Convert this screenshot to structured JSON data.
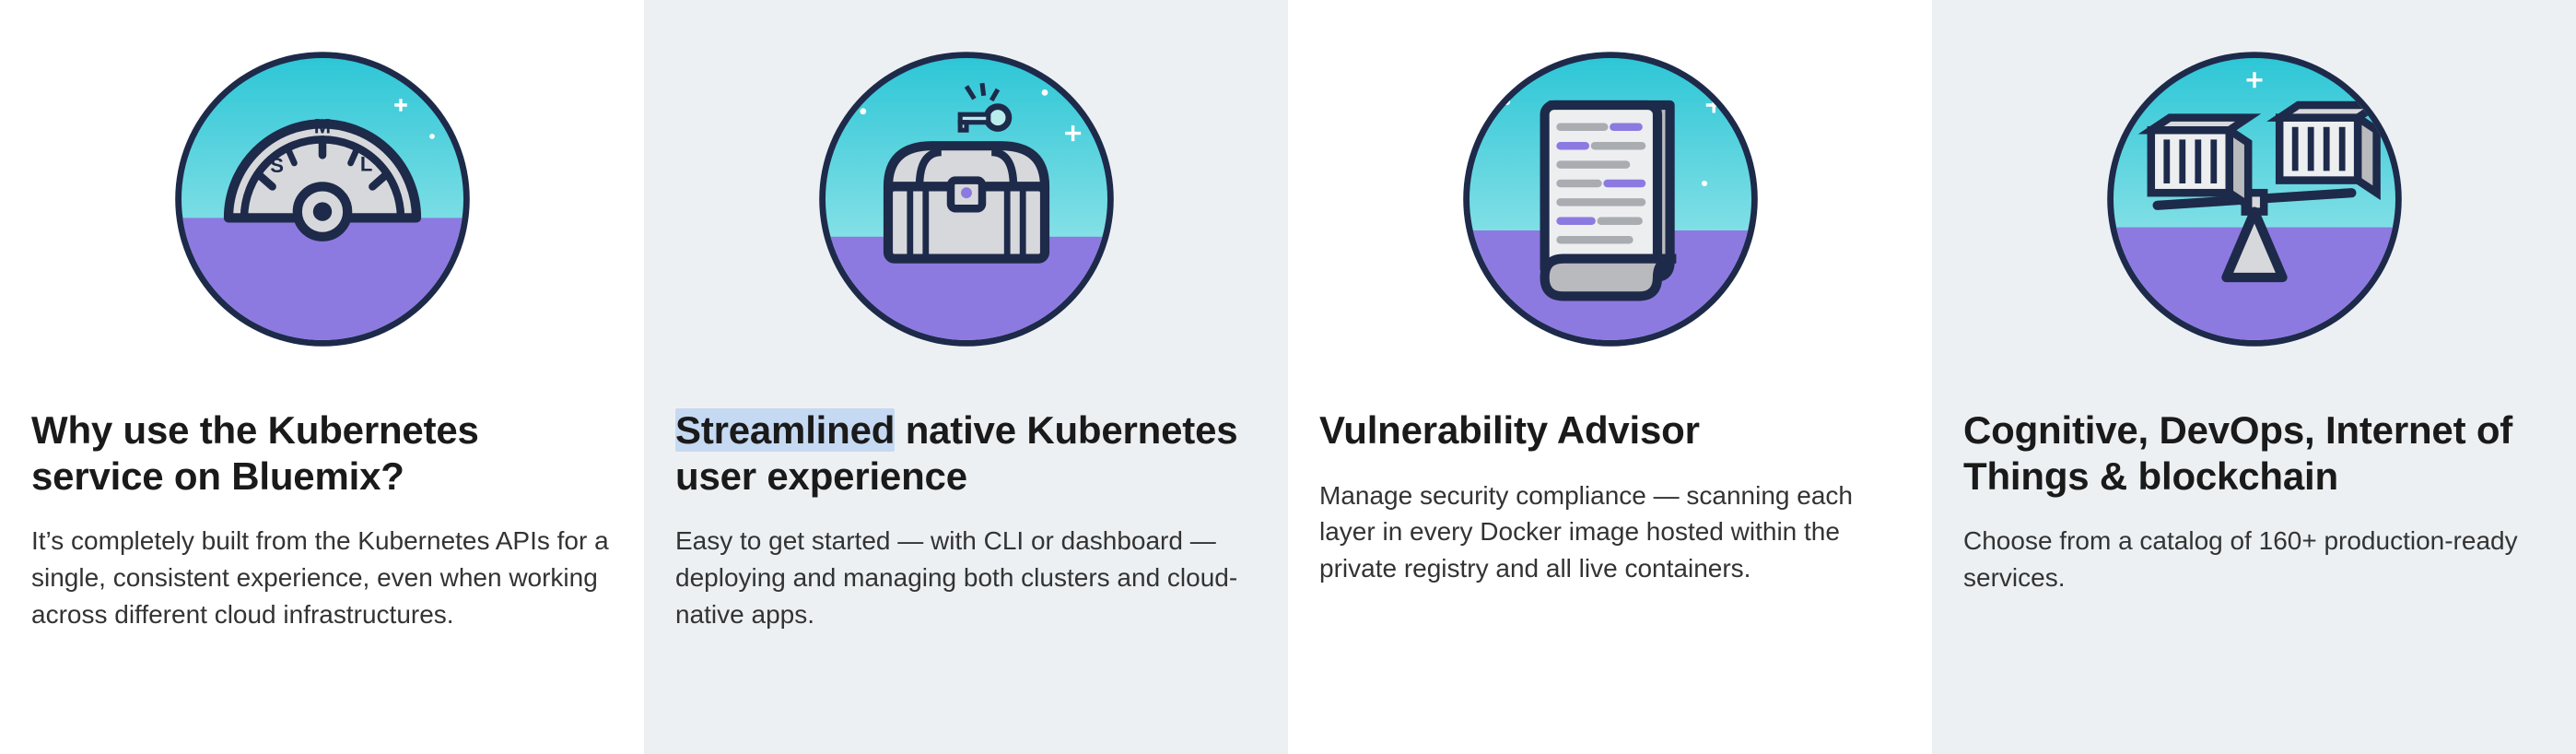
{
  "features": [
    {
      "title": "Why use the Kubernetes service on Bluemix?",
      "body": "It’s completely built from the Kubernetes APIs for a single, consistent experience, even when working across different cloud infrastructures."
    },
    {
      "title_prefix_highlight": "Streamlined",
      "title_rest": " native Kubernetes user experience",
      "body": "Easy to get started — with CLI or dashboard — deploying and managing both clusters and cloud-native apps."
    },
    {
      "title": "Vulnerability Advisor",
      "body": "Manage security compliance — scanning each layer in every Docker image hosted within the private registry and all live containers."
    },
    {
      "title": "Cognitive, DevOps, Internet of Things & blockchain",
      "body": "Choose from a catalog of 160+ production-ready services."
    }
  ]
}
